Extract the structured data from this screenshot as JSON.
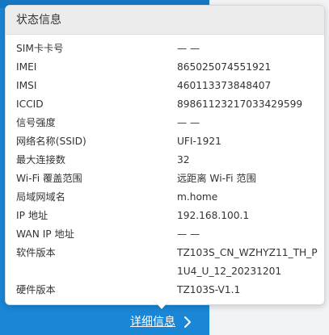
{
  "panel": {
    "title": "状态信息",
    "rows": [
      {
        "label": "SIM卡卡号",
        "value": "— —"
      },
      {
        "label": "IMEI",
        "value": "865025074551921"
      },
      {
        "label": "IMSI",
        "value": "460113373848407"
      },
      {
        "label": "ICCID",
        "value": "89861123217033429599"
      },
      {
        "label": "信号强度",
        "value": "— —"
      },
      {
        "label": "网络名称(SSID)",
        "value": "UFI-1921"
      },
      {
        "label": "最大连接数",
        "value": "32"
      },
      {
        "label": "Wi-Fi 覆盖范围",
        "value": "远距离 Wi-Fi 范围"
      },
      {
        "label": "局域网域名",
        "value": "m.home"
      },
      {
        "label": "IP 地址",
        "value": "192.168.100.1"
      },
      {
        "label": "WAN IP 地址",
        "value": "— —"
      },
      {
        "label": "软件版本",
        "value": "TZ103S_CN_WZHYZ11_TH_P1U4_U_12_20231201"
      },
      {
        "label": "硬件版本",
        "value": "TZ103S-V1.1"
      }
    ]
  },
  "details_link": {
    "label": "详细信息",
    "icon": "chevron-right-icon"
  },
  "colors": {
    "accent_blue": "#1a86d6",
    "card_background": "#ffffff",
    "header_background": "#ececec",
    "text": "#333333"
  }
}
